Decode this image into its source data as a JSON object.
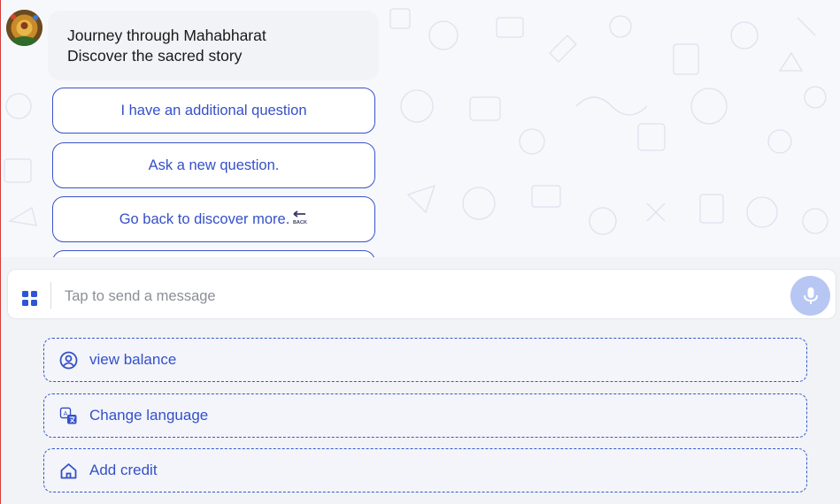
{
  "chat": {
    "message_lines": [
      "Journey through Mahabharat",
      "Discover the sacred story"
    ],
    "options": [
      {
        "label": "I have an additional question"
      },
      {
        "label": "Ask a new question."
      },
      {
        "label": "Go back to discover more.",
        "icon": "back-arrow-icon",
        "icon_text": "BACK"
      }
    ]
  },
  "composer": {
    "placeholder": "Tap to send a message",
    "menu_icon": "grid-icon",
    "mic_icon": "microphone-icon"
  },
  "actions": [
    {
      "label": "view balance",
      "icon": "user-circle-icon"
    },
    {
      "label": "Change language",
      "icon": "translate-icon"
    },
    {
      "label": "Add credit",
      "icon": "home-icon"
    }
  ],
  "colors": {
    "accent": "#3550c8",
    "mic_bg": "#b7c6f3",
    "bubble_bg": "#f1f3f6"
  }
}
